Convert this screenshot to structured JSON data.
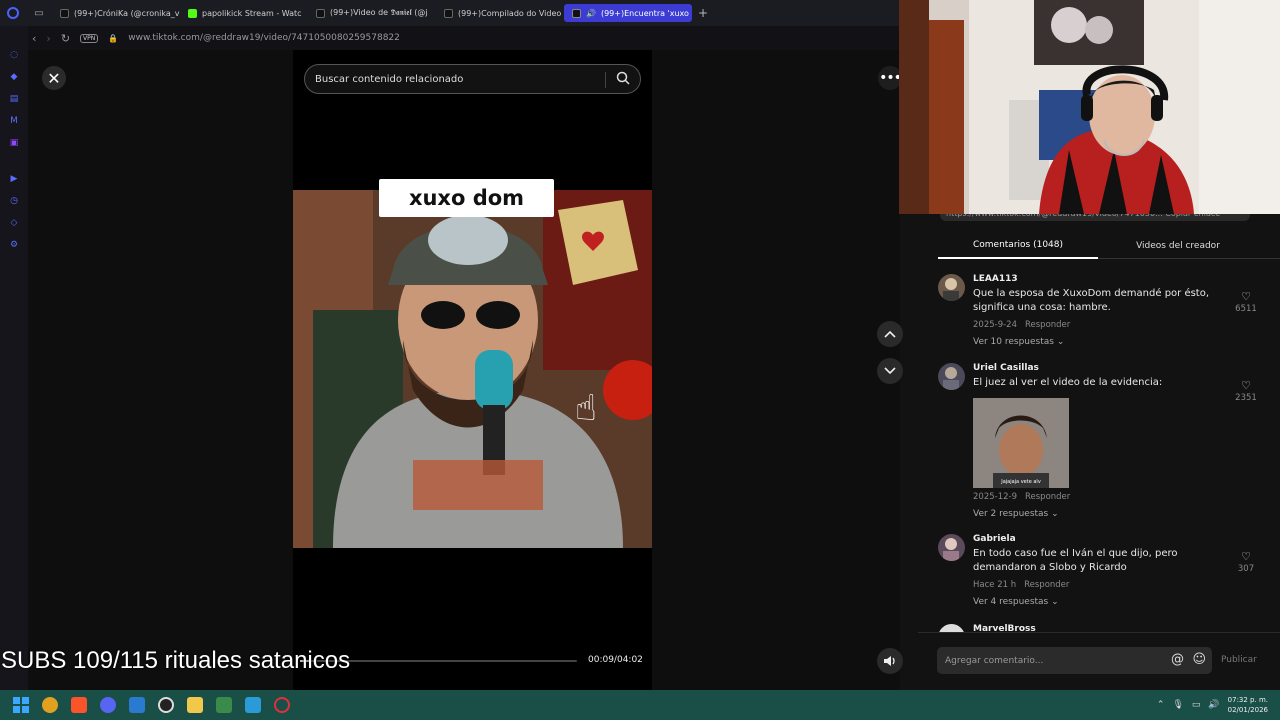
{
  "browser": {
    "tabs": [
      {
        "label": "(99+)CróniKa (@cronika_v",
        "color": "#222"
      },
      {
        "label": "papolikick Stream - Watc",
        "color": "#53fc18"
      },
      {
        "label": "(99+)Video de 𝕯𝖆𝖓𝖎𝖊𝖑 (@j",
        "color": "#222"
      },
      {
        "label": "(99+)Compilado do Video",
        "color": "#222"
      },
      {
        "label": "(99+)Encuentra 'xuxo",
        "color": "#222",
        "active": true
      }
    ],
    "vpn_label": "VPN",
    "url": "www.tiktok.com/@reddraw19/video/7471050080259578822"
  },
  "search": {
    "placeholder": "Buscar contenido relacionado"
  },
  "video": {
    "caption": "xuxo dom",
    "elapsed": "00:09",
    "duration": "04:02",
    "time_display": "00:09/04:02",
    "progress": 0.037
  },
  "overlay_text": "SUBS 109/115 rituales satanicos",
  "panel": {
    "url_strip": "https://www.tiktok.com/@reddraw19/video/7471050...   Copiar enlace",
    "tabs": [
      "Comentarios (1048)",
      "Videos del creador"
    ],
    "comments": [
      {
        "user": "LEAA113",
        "text": "Que la esposa de XuxoDom demandé por ésto, significa una cosa: hambre.",
        "date": "2025-9-24",
        "reply": "Responder",
        "replies": "Ver 10 respuestas",
        "likes": "6511"
      },
      {
        "user": "Uriel Casillas",
        "text": "El juez al ver el video de la evidencia:",
        "image_caption": "Jajajaja vete alv",
        "date": "2025-12-9",
        "reply": "Responder",
        "replies": "Ver 2 respuestas",
        "likes": "2351"
      },
      {
        "user": "Gabriela",
        "text": "En todo caso fue el Iván el que dijo, pero demandaron a Slobo y Ricardo",
        "date": "Hace 21 h",
        "reply": "Responder",
        "replies": "Ver 4 respuestas",
        "likes": "307"
      }
    ],
    "partial_user": "MarvelBross",
    "comment_placeholder": "Agregar comentario...",
    "publish": "Publicar"
  },
  "taskbar": {
    "time": "07:32 p. m.",
    "date": "02/01/2026"
  }
}
